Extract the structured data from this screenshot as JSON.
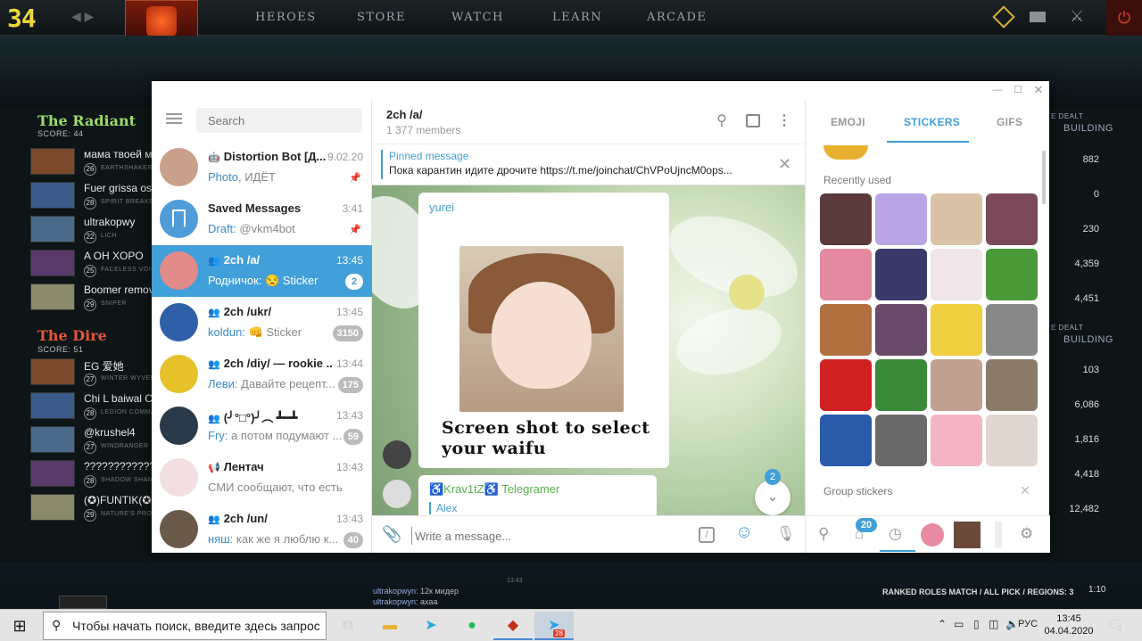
{
  "dota": {
    "counter": "34",
    "nav": [
      "HEROES",
      "STORE",
      "WATCH",
      "LEARN",
      "ARCADE"
    ],
    "radiant": {
      "title": "The Radiant",
      "score": "SCORE: 44"
    },
    "dire": {
      "title": "The Dire",
      "score": "SCORE: 51"
    },
    "radiant_players": [
      {
        "name": "мама твоей мам",
        "level": "26",
        "hero": "EARTHSHAKER"
      },
      {
        "name": "Fuer grissa ost dra",
        "level": "28",
        "hero": "SPIRIT BREAKER"
      },
      {
        "name": "ultrakopwy",
        "level": "22",
        "hero": "LICH"
      },
      {
        "name": "A OH XOPO",
        "level": "25",
        "hero": "FACELESS VOID"
      },
      {
        "name": "Boomer remove",
        "level": "29",
        "hero": "SNIPER"
      }
    ],
    "dire_players": [
      {
        "name": "EG 爱她",
        "level": "27",
        "hero": "WINTER WYVERN"
      },
      {
        "name": "Chi L baiwal Ch",
        "level": "28",
        "hero": "LEGION COMMANDER"
      },
      {
        "name": "@krushel4",
        "level": "27",
        "hero": "WINDRANGER"
      },
      {
        "name": "??????????????",
        "level": "28",
        "hero": "SHADOW SHAMAN"
      },
      {
        "name": "(✪)FUNTIK(✪",
        "level": "29",
        "hero": "NATURE'S PROPHET"
      }
    ],
    "right_headers": [
      "E DEALT",
      "BUILDING"
    ],
    "radiant_building": [
      "882",
      "0",
      "230",
      "4,359",
      "4,451"
    ],
    "dire_building": [
      "103",
      "6,086",
      "1,816",
      "4,418",
      "12,482"
    ],
    "chat_time": "13:43",
    "chat_lines": [
      {
        "user": "ultrakopwyn",
        "text": ": 12к мидер"
      },
      {
        "user": "ultrakopwyn",
        "text": ": ахаа"
      }
    ],
    "match_info": "RANKED ROLES MATCH / ALL PICK / REGIONS: 3",
    "match_time": "1:10"
  },
  "telegram": {
    "search_placeholder": "Search",
    "chats": [
      {
        "title": "Distortion Bot [Д...",
        "time": "9.02.20",
        "preview_author": "Photo,",
        "preview": " ИДЁТ",
        "badge": "",
        "pinned": true,
        "icon": "bot",
        "avatar_color": "#c9a089"
      },
      {
        "title": "Saved Messages",
        "time": "3:41",
        "preview_author": "Draft:",
        "preview": " @vkm4bot",
        "badge": "",
        "pinned": true,
        "icon": "",
        "avatar_color": "#4f9cd9"
      },
      {
        "title": "2ch /a/",
        "time": "13:45",
        "preview_author": "Родничок:",
        "preview": " 😒 Sticker",
        "badge": "2",
        "pinned": false,
        "icon": "group",
        "avatar_color": "#e08a8a"
      },
      {
        "title": "2ch /ukr/",
        "time": "13:45",
        "preview_author": "koldun:",
        "preview": " 👊 Sticker",
        "badge": "3150",
        "pinned": false,
        "icon": "group",
        "avatar_color": "#2f5fa8"
      },
      {
        "title": "2ch /diy/ — rookie ...",
        "time": "13:44",
        "preview_author": "Леви:",
        "preview": " Давайте рецепт...",
        "badge": "175",
        "pinned": false,
        "icon": "group",
        "avatar_color": "#e6c12a"
      },
      {
        "title": "(╯°□°)╯︵ ┻━┻",
        "time": "13:43",
        "preview_author": "Fry:",
        "preview": " а потом подумают ...",
        "badge": "59",
        "pinned": false,
        "icon": "group",
        "avatar_color": "#2a3a4a"
      },
      {
        "title": "Лентач",
        "time": "13:43",
        "preview_author": "",
        "preview": "СМИ сообщают, что есть по...",
        "badge": "",
        "pinned": false,
        "icon": "channel",
        "avatar_color": "#f2dfe2"
      },
      {
        "title": "2ch /un/",
        "time": "13:43",
        "preview_author": "няш:",
        "preview": " как же я люблю к...",
        "badge": "40",
        "pinned": false,
        "icon": "group",
        "avatar_color": "#6a5a4a"
      }
    ],
    "active_chat": {
      "title": "2ch /a/",
      "members": "1 377 members",
      "pinned_label": "Pinned message",
      "pinned_text": "Пока карантин идите дрочите https://t.me/joinchat/ChVPoUjncM0ops...",
      "messages": [
        {
          "author": "yurei",
          "sticker_caption": "Screen shot to select your waifu"
        },
        {
          "author": "♿Krav1tZ♿ Telegramer",
          "reply_to": "Alex"
        }
      ],
      "unread_count": "2",
      "input_placeholder": "Write a message..."
    },
    "sticker_panel": {
      "tabs": [
        "EMOJI",
        "STICKERS",
        "GIFS"
      ],
      "active_tab": "STICKERS",
      "recent_label": "Recently used",
      "group_label": "Group stickers",
      "sets_badge": "20",
      "sticker_colors": [
        "#5a3a3a",
        "#b9a4e6",
        "#d9c2a6",
        "#7a4a5a",
        "#e48aa0",
        "#3a3a6a",
        "#f0e6ea",
        "#4a9a3a",
        "#b07040",
        "#6a4a6a",
        "#f0d040",
        "#888888",
        "#d02020",
        "#3a8a3a",
        "#c0a090",
        "#8a7a6a",
        "#2a5aaa",
        "#6a6a6a",
        "#f4b4c4",
        "#e0d8d0"
      ]
    }
  },
  "taskbar": {
    "search_placeholder": "Чтобы начать поиск, введите здесь запрос",
    "tray_lang": "РУС",
    "time": "13:45",
    "date": "04.04.2020",
    "notif_count": "1",
    "telegram_badge": "28"
  }
}
